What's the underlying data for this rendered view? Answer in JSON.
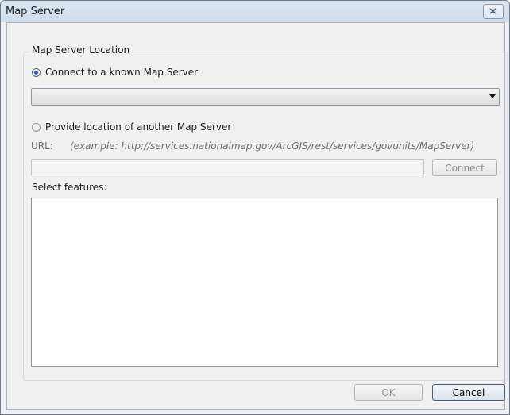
{
  "window": {
    "title": "Map Server",
    "close_icon": "close-icon"
  },
  "group": {
    "legend": "Map Server Location"
  },
  "known_server": {
    "label": "Connect to a known Map Server",
    "selected": true,
    "combo_value": ""
  },
  "other_server": {
    "label": "Provide location of another Map Server",
    "selected": false,
    "url_label": "URL:",
    "url_example": "(example: http://services.nationalmap.gov/ArcGIS/rest/services/govunits/MapServer)",
    "url_value": "",
    "connect_label": "Connect"
  },
  "features": {
    "label": "Select features:",
    "items": []
  },
  "footer": {
    "ok_label": "OK",
    "cancel_label": "Cancel"
  },
  "colors": {
    "radio_checked": "#1e5fc2",
    "default_button_border": "#3f5f86"
  }
}
